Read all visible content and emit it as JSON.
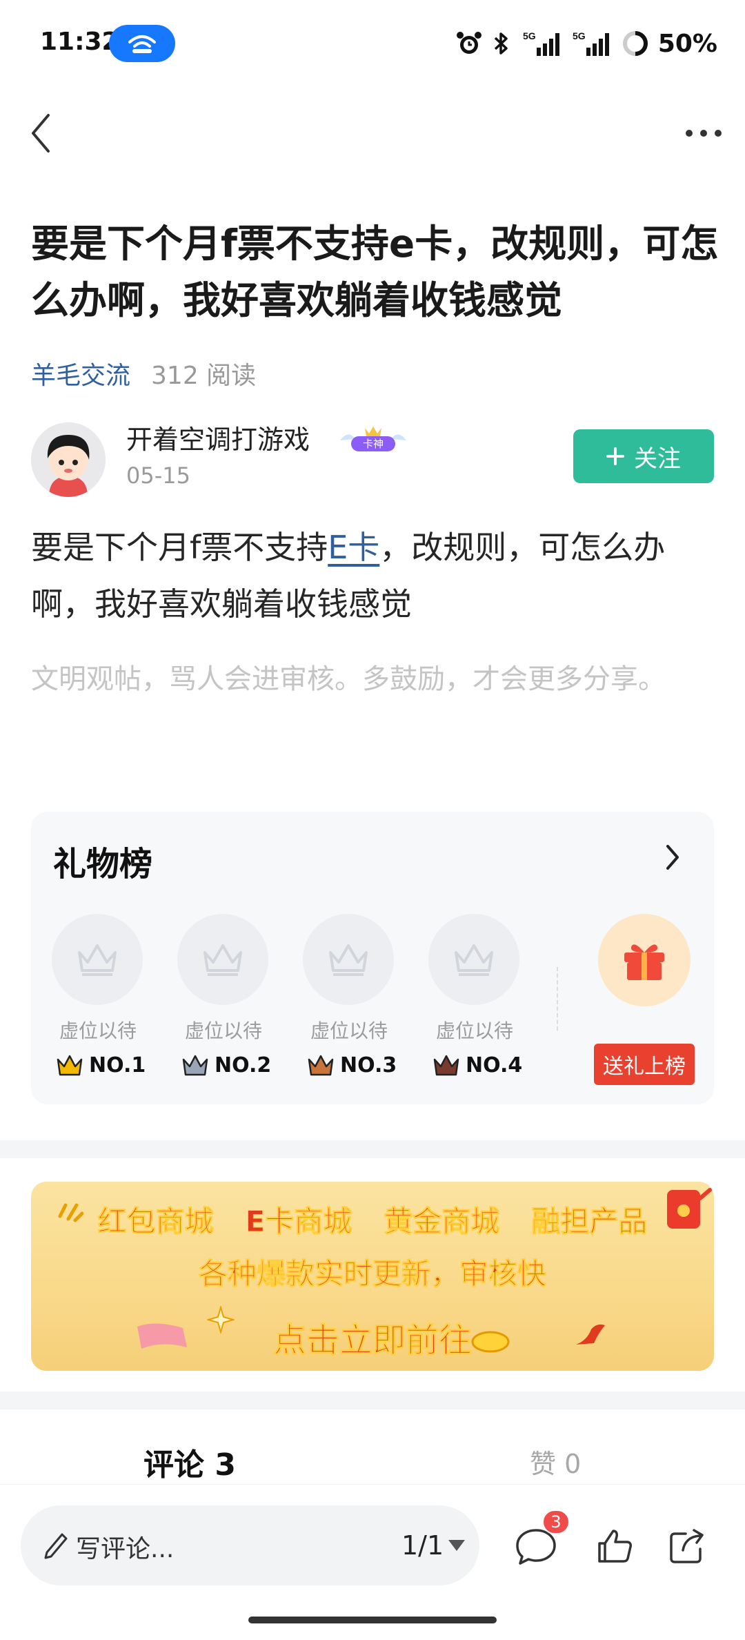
{
  "status_bar": {
    "time": "11:32",
    "battery": "50%",
    "icons": [
      "hotspot-icon",
      "alarm-icon",
      "bluetooth-icon",
      "signal-5g-icon",
      "signal-5g-icon",
      "battery-icon"
    ]
  },
  "nav": {
    "back_icon": "chevron-left-icon",
    "more_icon": "more-dots-icon"
  },
  "post": {
    "title": "要是下个月f票不支持e卡，改规则，可怎么办啊，我好喜欢躺着收钱感觉",
    "category": "羊毛交流",
    "reads": "312 阅读",
    "body_before": "要是下个月f票不支持",
    "body_link": "E卡",
    "body_after": "，改规则，可怎么办啊，我好喜欢躺着收钱感觉",
    "notice": "文明观帖，骂人会进审核。多鼓励，才会更多分享。"
  },
  "author": {
    "name": "开着空调打游戏",
    "badge_text": "卡神",
    "date": "05-15",
    "follow_label": "关注"
  },
  "gift_board": {
    "title": "礼物榜",
    "slots": [
      {
        "label": "虚位以待",
        "rank": "NO.1",
        "crown_color": "#f5b800"
      },
      {
        "label": "虚位以待",
        "rank": "NO.2",
        "crown_color": "#9aa6b8"
      },
      {
        "label": "虚位以待",
        "rank": "NO.3",
        "crown_color": "#c8743a"
      },
      {
        "label": "虚位以待",
        "rank": "NO.4",
        "crown_color": "#7a3b2e"
      }
    ],
    "send_label": "送礼上榜"
  },
  "banner": {
    "items": [
      "红包商城",
      "E卡商城",
      "黄金商城",
      "融担产品"
    ],
    "tagline": "各种爆款实时更新，审核快",
    "cta": "点击立即前往"
  },
  "tabs": {
    "comments": "评论 3",
    "likes": "赞 0"
  },
  "bottom_bar": {
    "comment_placeholder": "写评论...",
    "page": "1/1",
    "comment_count": "3"
  },
  "colors": {
    "accent_green": "#2fbc9b",
    "link_blue": "#2f5f9e",
    "badge_red": "#e8412f"
  }
}
